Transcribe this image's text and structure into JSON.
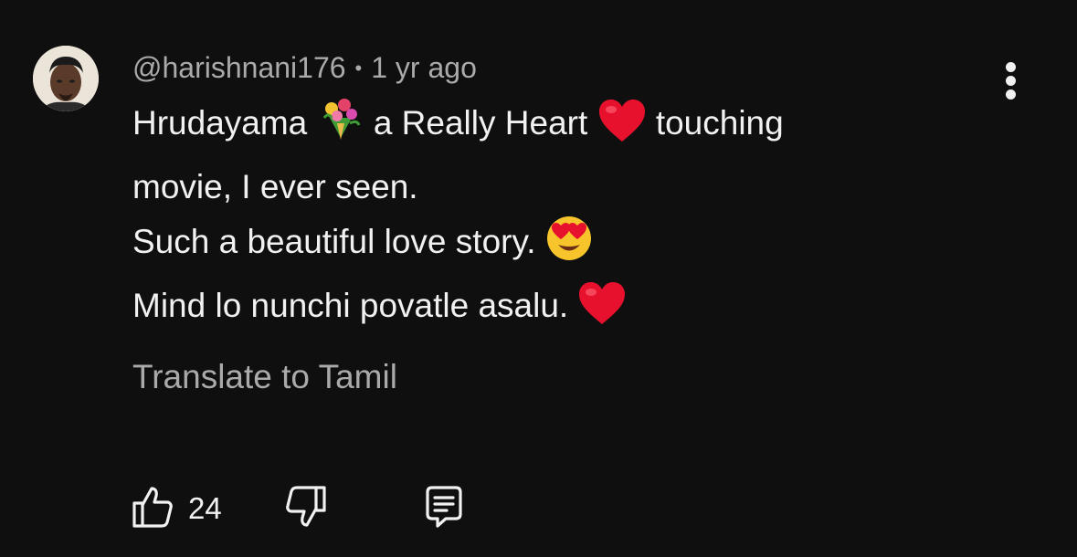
{
  "comment": {
    "author": "@harishnani176",
    "separator": "•",
    "timestamp": "1 yr ago",
    "lines": [
      {
        "text": "Hrudayama ",
        "emoji": "bouquet-emoji",
        "after": " a Really Heart ",
        "emoji2": "red-heart-emoji",
        "tail": " touching"
      },
      {
        "text": "movie, I ever seen."
      },
      {
        "text": "Such a beautiful love story. ",
        "emoji": "heart-eyes-emoji"
      },
      {
        "text": "Mind lo nunchi povatle asalu. ",
        "emoji": "red-heart-emoji"
      }
    ],
    "line1_a": "Hrudayama",
    "line1_b": "a Really Heart",
    "line1_c": "touching",
    "line2": "movie, I ever seen.",
    "line3": "Such a beautiful love story.",
    "line4": "Mind lo nunchi povatle asalu.",
    "translate_label": "Translate to Tamil",
    "like_count": "24"
  },
  "icons": {
    "avatar": "user-avatar",
    "menu": "more-vert-icon",
    "like": "thumb-up-icon",
    "dislike": "thumb-down-icon",
    "reply": "comment-reply-icon"
  },
  "colors": {
    "background": "#0f0f0f",
    "primary_text": "#f1f1f1",
    "secondary_text": "#aaaaaa",
    "heart": "#e8112d"
  }
}
